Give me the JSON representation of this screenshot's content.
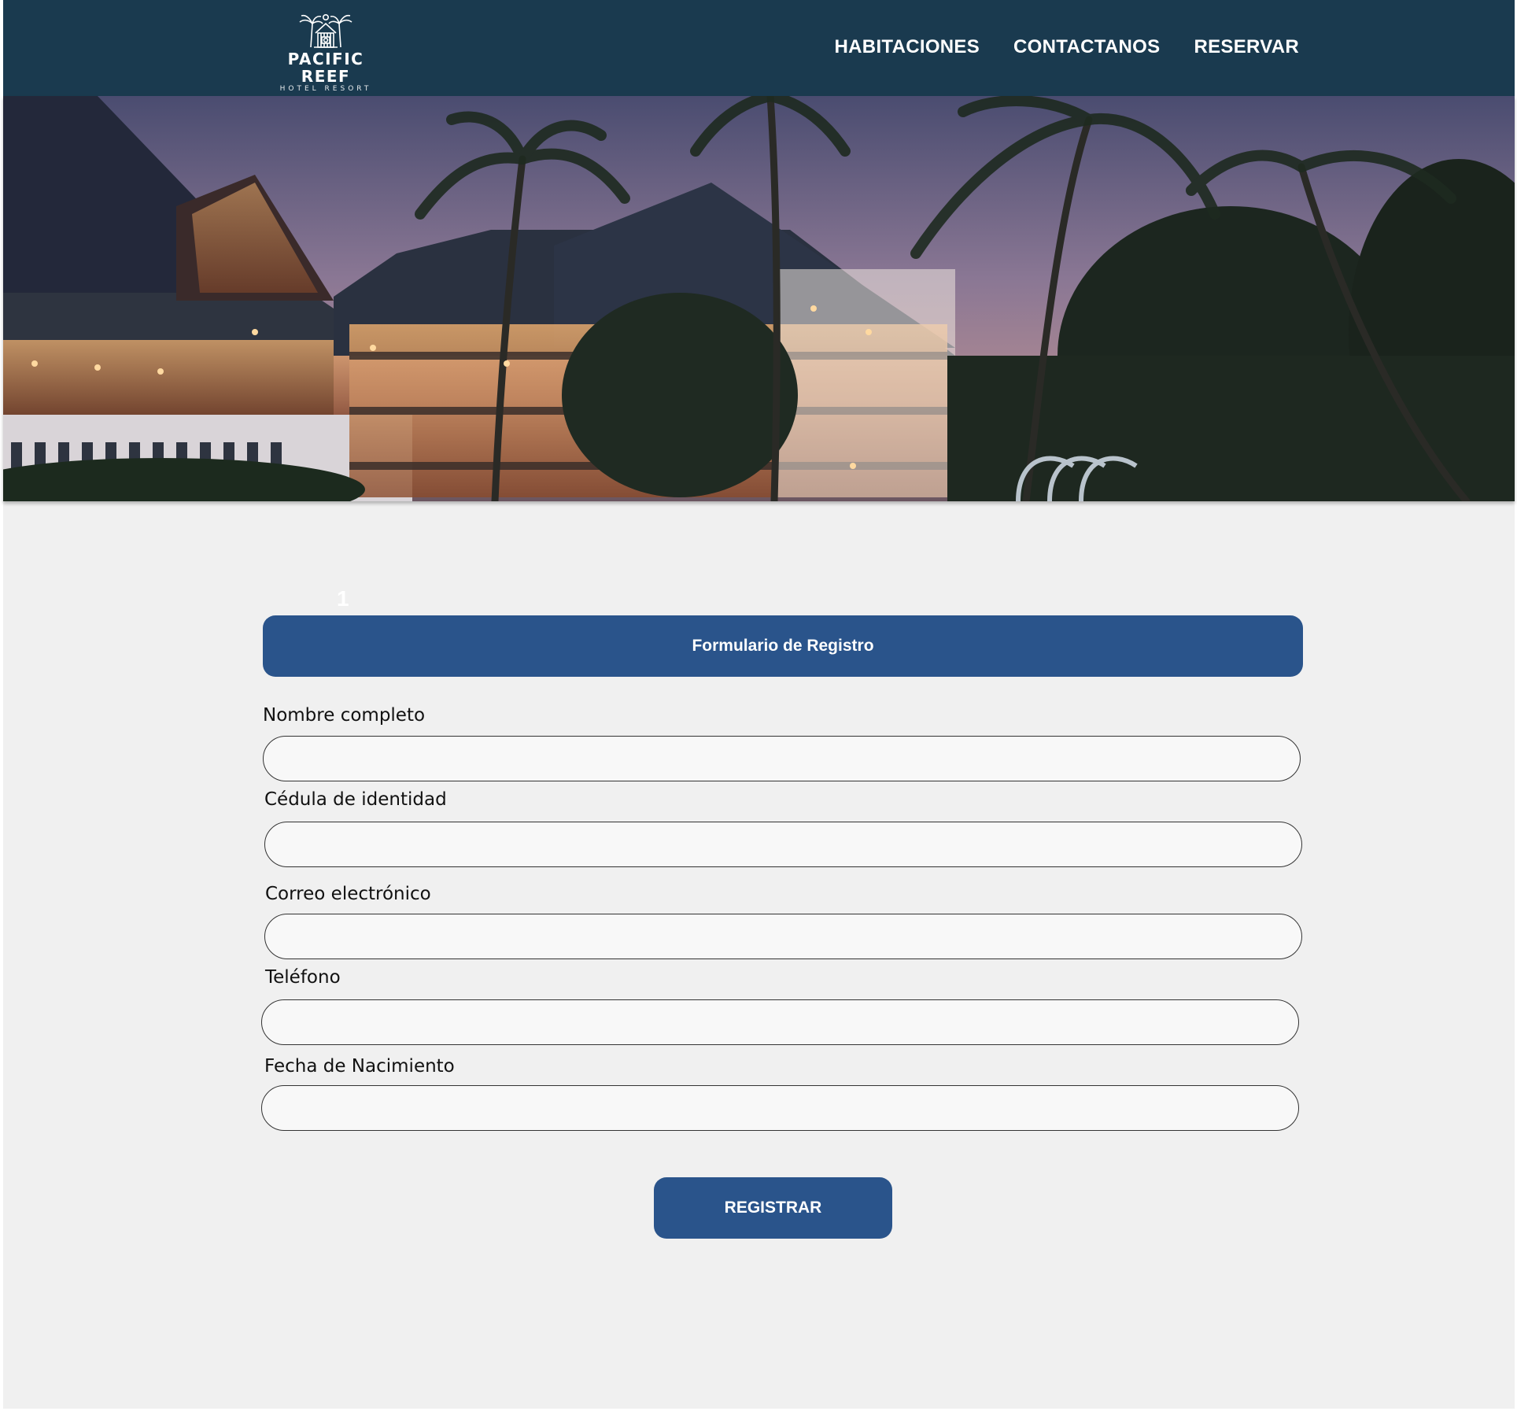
{
  "brand": {
    "name": "PACIFIC REEF",
    "subtitle": "HOTEL RESORT",
    "logo_icon": "palm-hut-logo"
  },
  "nav": {
    "items": [
      {
        "label": "HABITACIONES"
      },
      {
        "label": "CONTACTANOS"
      },
      {
        "label": "RESERVAR"
      }
    ]
  },
  "hero": {
    "image": "hotel-resort-at-dusk-with-palm-trees"
  },
  "form": {
    "step_number": "1",
    "title": "Formulario de Registro",
    "fields": [
      {
        "label": "Nombre completo",
        "value": ""
      },
      {
        "label": "Cédula de identidad",
        "value": ""
      },
      {
        "label": "Correo electrónico",
        "value": ""
      },
      {
        "label": "Teléfono",
        "value": ""
      },
      {
        "label": "Fecha de Nacimiento",
        "value": ""
      }
    ],
    "submit_label": "REGISTRAR"
  },
  "colors": {
    "header_bg": "#1a3a4f",
    "accent": "#2a548b",
    "page_bg": "#f0f0f0",
    "input_bg": "#f8f8f8"
  }
}
